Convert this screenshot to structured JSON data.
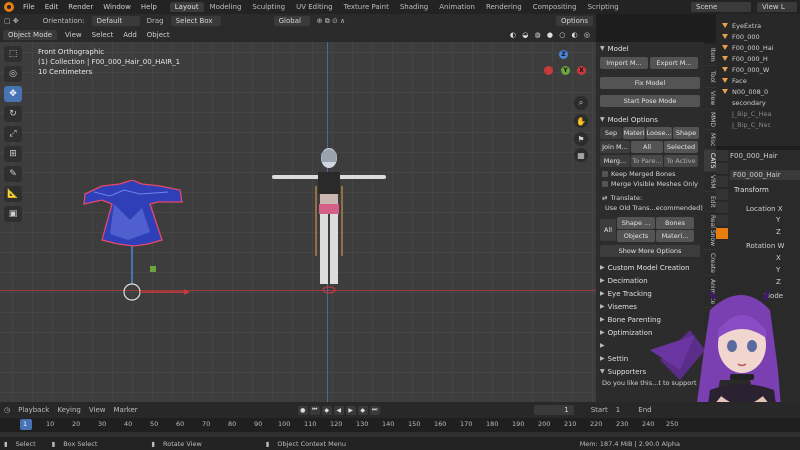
{
  "menu": {
    "items": [
      "File",
      "Edit",
      "Render",
      "Window",
      "Help"
    ],
    "workspaces": [
      "Layout",
      "Modeling",
      "Sculpting",
      "UV Editing",
      "Texture Paint",
      "Shading",
      "Animation",
      "Rendering",
      "Compositing",
      "Scripting"
    ],
    "active_workspace": "Layout",
    "scene": "Scene",
    "view_layer": "View L"
  },
  "header": {
    "orientation_label": "Orientation:",
    "orientation_value": "Default",
    "drag_label": "Drag",
    "drag_value": "Select Box",
    "transform_space": "Global",
    "options": "Options"
  },
  "viewport_header": {
    "mode": "Object Mode",
    "menus": [
      "View",
      "Select",
      "Add",
      "Object"
    ]
  },
  "viewport": {
    "view_name": "Front Orthographic",
    "collection": "(1) Collection | F00_000_Hair_00_HAIR_1",
    "scale": "10 Centimeters"
  },
  "npanel": {
    "model_title": "Model",
    "import_btn": "Import M...",
    "export_btn": "Export M...",
    "fix_btn": "Fix Model",
    "pose_btn": "Start Pose Mode",
    "options_title": "Model Options",
    "sep": "Sep",
    "materials": "Materi",
    "loose": "Loose...",
    "shape": "Shape",
    "join": "Join M...",
    "all": "All",
    "selected": "Selected",
    "merge": "Merg...",
    "to_parent": "To Pare...",
    "to_active": "To Active",
    "keep_merged": "Keep Merged Bones",
    "merge_visible": "Merge Visible Meshes Only",
    "translate": "Translate:",
    "use_old": "Use Old Trans...ecommended)",
    "all2": "All",
    "shape2": "Shape ...",
    "bones": "Bones",
    "objects": "Objects",
    "materials2": "Materi...",
    "show_more": "Show More Options",
    "sections": [
      "Custom Model Creation",
      "Decimation",
      "Eye Tracking",
      "Visemes",
      "Bone Parenting",
      "Optimization",
      "",
      "Settin",
      "Supporters"
    ],
    "supporters_text": "Do you like this...t to support"
  },
  "tabs": [
    "Item",
    "Tool",
    "View",
    "MMD",
    "Misc",
    "CATS",
    "VRM",
    "Edit",
    "Real Snow",
    "Create",
    "Animate",
    "Paper",
    "Coat"
  ],
  "outliner": {
    "items": [
      "EyeExtra",
      "F00_000",
      "F00_000_Hai",
      "F00_000_H",
      "F00_000_W",
      "Face",
      "N00_008_0",
      "secondary",
      "J_Bip_C_Hea",
      "J_Bip_C_Nec"
    ]
  },
  "properties": {
    "object_name": "F00_000_Hair",
    "object_name2": "F00_000_Hair",
    "transform_title": "Transform",
    "location_label": "Location X",
    "y": "Y",
    "z": "Z",
    "rotation_label": "Rotation W",
    "x": "X",
    "mode_label": "Mode",
    "rot_mode": "Qu"
  },
  "timeline": {
    "menus": [
      "Playback",
      "Keying",
      "View",
      "Marker"
    ],
    "current_frame": "1",
    "start_label": "Start",
    "start": "1",
    "end_label": "End",
    "ticks": [
      "1",
      "10",
      "20",
      "30",
      "40",
      "50",
      "60",
      "70",
      "80",
      "90",
      "100",
      "110",
      "120",
      "130",
      "140",
      "150",
      "160",
      "170",
      "180",
      "190",
      "200",
      "210",
      "220",
      "230",
      "240",
      "250"
    ]
  },
  "status": {
    "select": "Select",
    "box_select": "Box Select",
    "rotate": "Rotate View",
    "context": "Object Context Menu",
    "info": "Mem: 187.4 MiB | 2.90.0 Alpha"
  },
  "colors": {
    "accent": "#4772b3",
    "x_axis": "#c83a3a",
    "y_axis": "#6ca53c",
    "z_axis": "#4a84d6",
    "avatar_hair": "#7a3fb0",
    "dress": "#3a3aa8"
  }
}
